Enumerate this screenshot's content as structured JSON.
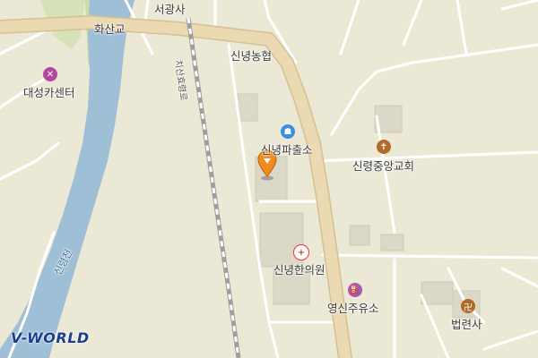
{
  "map": {
    "colors": {
      "background": "#ece8d6",
      "river": "#9fbfd6",
      "park": "#c7d9a5",
      "road_main": "#ead9b1",
      "road_edge": "#d4c190",
      "road_minor": "#ffffff",
      "railway": "#9e9e9e",
      "building": "#d8d4c4",
      "marker": "#f08c1e"
    },
    "labels": {
      "seogwangsa": "서광사",
      "hwasangyo": "화산교",
      "daeseong_car_center": "대성카센터",
      "sinnyeong_nonghyup": "신녕농협",
      "sinnyeong_police": "신녕파출소",
      "sinnyeong_jungang_church": "신령중앙교회",
      "sinnyeong_clinic": "신녕한의원",
      "yeongsin_gas_station": "영신주유소",
      "beopyeonsa": "법련사",
      "sinnyeong_stream": "신령천",
      "chisan_road": "치산효령로"
    },
    "icons": {
      "car_center": "wrench-icon",
      "police": "police-icon",
      "church": "church-icon",
      "clinic": "hospital-icon",
      "gas_station": "fuel-icon",
      "temple": "temple-icon",
      "location_marker": "location-pin-icon"
    },
    "logo": "V-WORLD"
  }
}
